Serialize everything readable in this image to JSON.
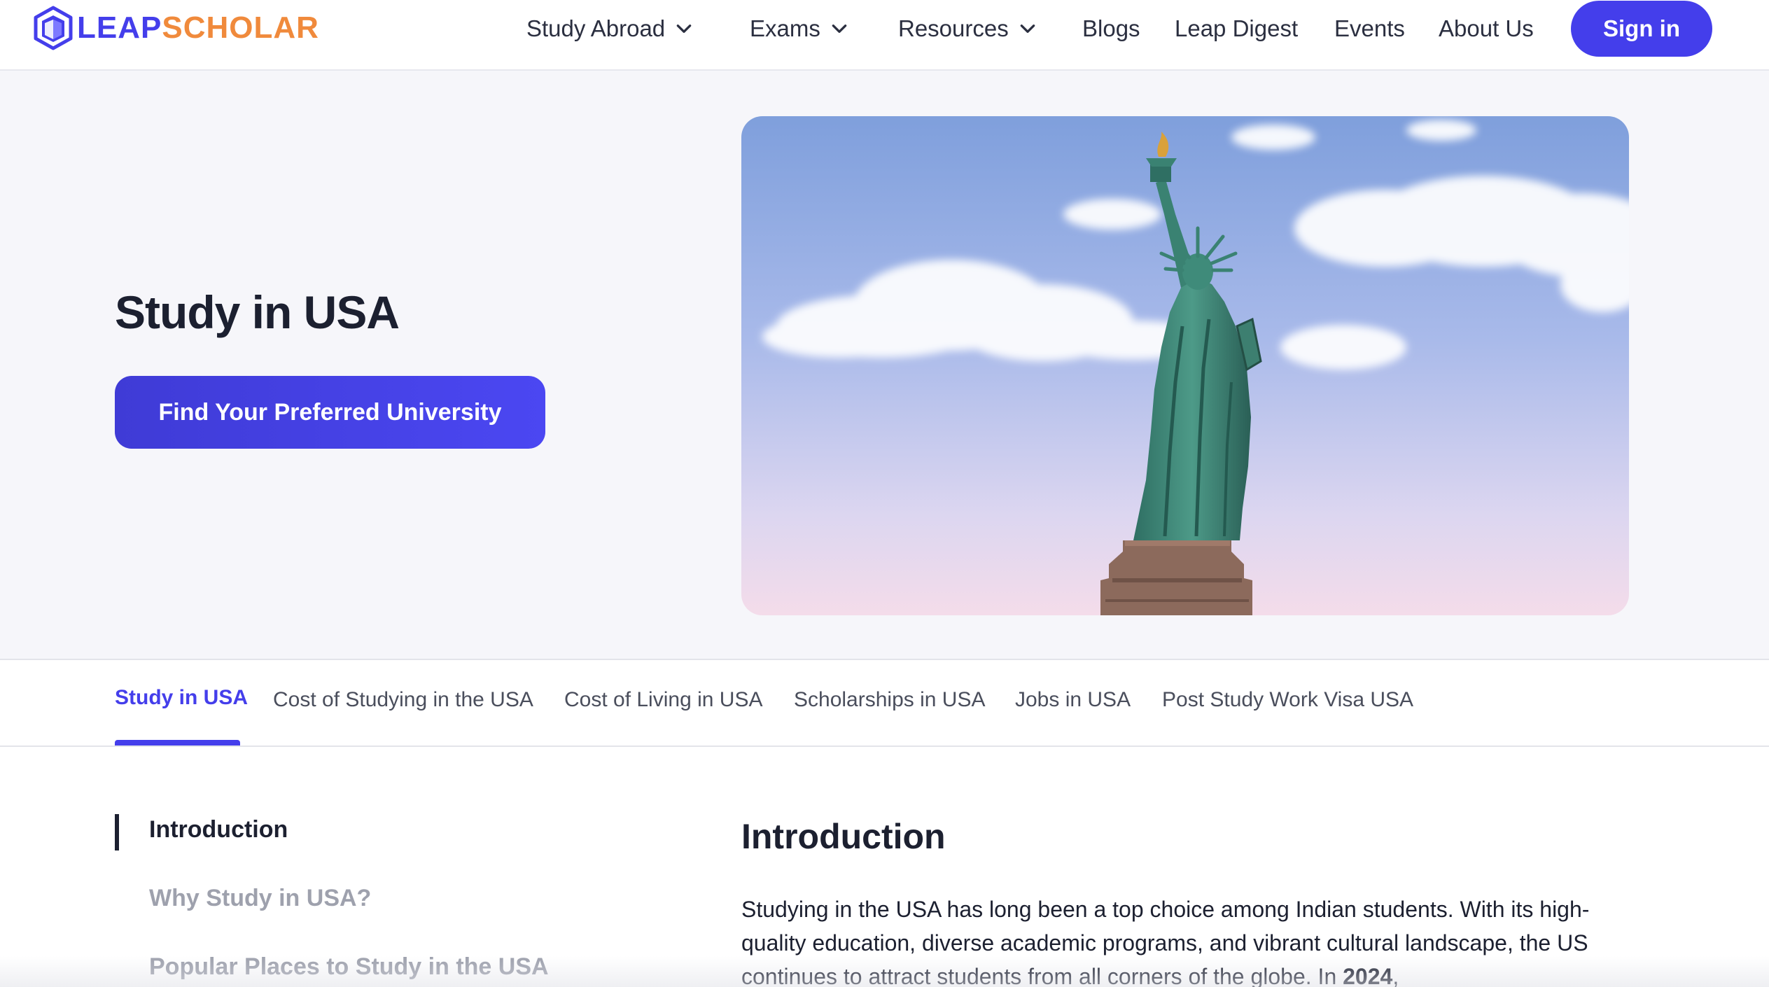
{
  "brand": {
    "leap": "LEAP",
    "scholar": "SCHOLAR",
    "primary_color": "#443eeb",
    "accent_color": "#f08a3c"
  },
  "nav": {
    "items": [
      {
        "label": "Study Abroad",
        "has_dropdown": true
      },
      {
        "label": "Exams",
        "has_dropdown": true
      },
      {
        "label": "Resources",
        "has_dropdown": true
      },
      {
        "label": "Blogs",
        "has_dropdown": false
      },
      {
        "label": "Leap Digest",
        "has_dropdown": false
      },
      {
        "label": "Events",
        "has_dropdown": false
      },
      {
        "label": "About Us",
        "has_dropdown": false
      }
    ],
    "signin_label": "Sign in"
  },
  "hero": {
    "title": "Study in USA",
    "cta_label": "Find Your Preferred University",
    "image_subject": "statue-of-liberty"
  },
  "tabs": {
    "active_index": 0,
    "items": [
      "Study in USA",
      "Cost of Studying in the USA",
      "Cost of Living in USA",
      "Scholarships in USA",
      "Jobs in USA",
      "Post Study Work Visa USA"
    ]
  },
  "toc": {
    "active_index": 0,
    "items": [
      "Introduction",
      "Why Study in USA?",
      "Popular Places to Study in the USA"
    ]
  },
  "content": {
    "section_title": "Introduction",
    "paragraph_start": "Studying in the USA has long been a top choice among Indian students. With its high-quality education, diverse academic programs, and vibrant cultural landscape, the US continues to attract students from all corners of the globe. In ",
    "paragraph_bold": "2024",
    "paragraph_end": ","
  }
}
